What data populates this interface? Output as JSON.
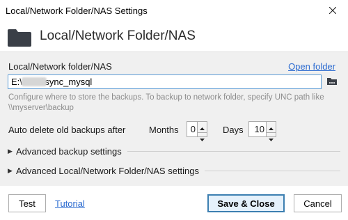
{
  "window": {
    "title": "Local/Network Folder/NAS Settings"
  },
  "header": {
    "title": "Local/Network Folder/NAS"
  },
  "folder": {
    "label": "Local/Network folder/NAS",
    "open_folder_link": "Open folder",
    "path_value": "E:\\        \\sync_mysql",
    "help_text": "Configure where to store the backups. To backup to network folder, specify UNC path like \\\\myserver\\backup"
  },
  "auto_delete": {
    "label": "Auto delete old backups after",
    "months_label": "Months",
    "months_value": "0",
    "days_label": "Days",
    "days_value": "10"
  },
  "sections": [
    {
      "label": "Advanced backup settings"
    },
    {
      "label": "Advanced Local/Network Folder/NAS settings"
    }
  ],
  "footer": {
    "test_label": "Test",
    "tutorial_label": "Tutorial",
    "save_label": "Save & Close",
    "cancel_label": "Cancel"
  },
  "icons": {
    "header": "folder-icon",
    "browse": "browse-folder-icon",
    "close": "close-icon",
    "spin_up": "spin-up-icon",
    "spin_down": "spin-down-icon",
    "expand": "expand-triangle-icon"
  },
  "colors": {
    "link": "#2a6ad0",
    "primary_border": "#3c7fb1",
    "input_focus": "#5b9bd5"
  }
}
